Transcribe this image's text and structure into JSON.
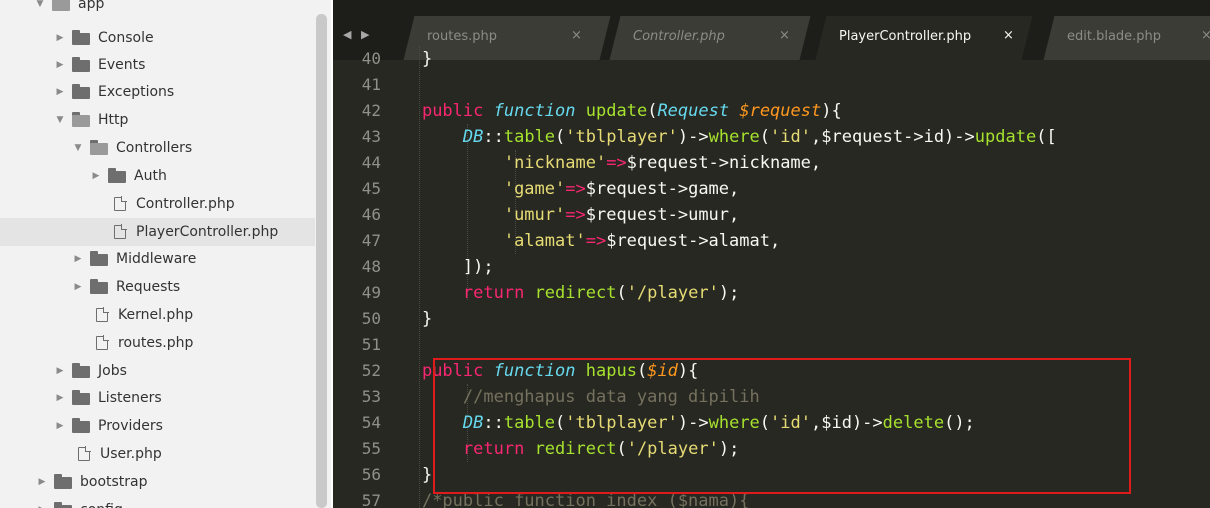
{
  "sidebar": {
    "items": [
      {
        "label": "app",
        "type": "folder",
        "open": true
      },
      {
        "label": "Console",
        "type": "folder",
        "open": false
      },
      {
        "label": "Events",
        "type": "folder",
        "open": false
      },
      {
        "label": "Exceptions",
        "type": "folder",
        "open": false
      },
      {
        "label": "Http",
        "type": "folder",
        "open": true
      },
      {
        "label": "Controllers",
        "type": "folder",
        "open": true
      },
      {
        "label": "Auth",
        "type": "folder",
        "open": false
      },
      {
        "label": "Controller.php",
        "type": "file"
      },
      {
        "label": "PlayerController.php",
        "type": "file",
        "selected": true
      },
      {
        "label": "Middleware",
        "type": "folder",
        "open": false
      },
      {
        "label": "Requests",
        "type": "folder",
        "open": false
      },
      {
        "label": "Kernel.php",
        "type": "file"
      },
      {
        "label": "routes.php",
        "type": "file"
      },
      {
        "label": "Jobs",
        "type": "folder",
        "open": false
      },
      {
        "label": "Listeners",
        "type": "folder",
        "open": false
      },
      {
        "label": "Providers",
        "type": "folder",
        "open": false
      },
      {
        "label": "User.php",
        "type": "file"
      },
      {
        "label": "bootstrap",
        "type": "folder",
        "open": false
      },
      {
        "label": "config",
        "type": "folder",
        "open": false
      }
    ]
  },
  "tabs": {
    "nav_arrows": "◀ ▶",
    "items": [
      {
        "label": "routes.php",
        "close": "×",
        "active": false
      },
      {
        "label": "Controller.php",
        "close": "×",
        "active": false
      },
      {
        "label": "PlayerController.php",
        "close": "×",
        "active": true
      },
      {
        "label": "edit.blade.php",
        "close": "×",
        "active": false
      }
    ]
  },
  "editor": {
    "line_numbers": [
      "40",
      "41",
      "42",
      "43",
      "44",
      "45",
      "46",
      "47",
      "48",
      "49",
      "50",
      "51",
      "52",
      "53",
      "54",
      "55",
      "56",
      "57"
    ],
    "highlight_color": "#e01b1b",
    "theme": {
      "background": "#272822",
      "keyword": "#f92672",
      "type": "#66d9ef",
      "function": "#a6e22e",
      "string": "#e6db74",
      "comment": "#75715e",
      "param": "#fd971f"
    }
  }
}
